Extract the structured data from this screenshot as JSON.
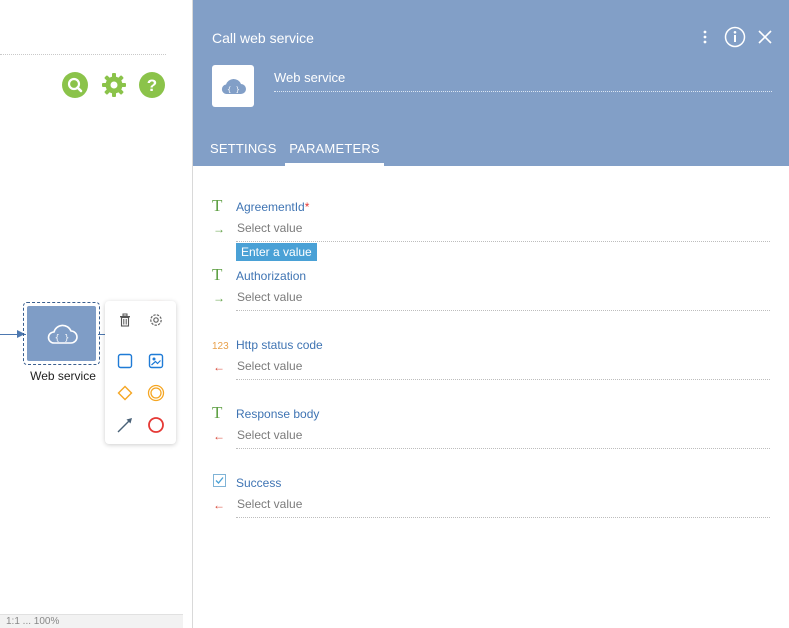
{
  "canvas": {
    "toolbar": [
      {
        "icon": "search-icon",
        "color": "#8bc34a"
      },
      {
        "icon": "gear-icon",
        "color": "#8bc34a"
      },
      {
        "icon": "help-icon",
        "color": "#8bc34a"
      }
    ],
    "node": {
      "label": "Web service",
      "color": "#7f9dc6",
      "icon": "cloud-code-icon"
    },
    "node_menu": [
      {
        "icon": "trash-icon"
      },
      {
        "icon": "settings-icon"
      },
      {
        "icon": "task-square-icon",
        "color": "#1f7bd6"
      },
      {
        "icon": "image-task-icon",
        "color": "#1f7bd6"
      },
      {
        "icon": "gateway-diamond-icon",
        "color": "#f5a623"
      },
      {
        "icon": "intermediate-event-icon",
        "color": "#f5a623"
      },
      {
        "icon": "flow-arrow-icon",
        "color": "#4a6278"
      },
      {
        "icon": "end-event-icon",
        "color": "#e53935"
      }
    ],
    "status_bar": "1:1          ...         100%"
  },
  "panel": {
    "title": "Call web service",
    "header_color": "#829fc7",
    "element_name": "Web service",
    "tabs": [
      {
        "label": "SETTINGS",
        "active": false
      },
      {
        "label": "PARAMETERS",
        "active": true
      }
    ],
    "parameters": [
      {
        "type_icon": "T",
        "name": "AgreementId",
        "required": "*",
        "direction": "→",
        "placeholder": "Select value"
      },
      {
        "type_icon": "T",
        "name": "Authorization",
        "direction": "→",
        "placeholder": "Select value"
      },
      {
        "type_icon": "123",
        "name": "Http status code",
        "direction": "←",
        "placeholder": "Select value"
      },
      {
        "type_icon": "T",
        "name": "Response body",
        "direction": "←",
        "placeholder": "Select value"
      },
      {
        "type_icon": "checkbox",
        "name": "Success",
        "direction": "←",
        "placeholder": "Select value"
      }
    ],
    "tooltip": "Enter a value"
  }
}
